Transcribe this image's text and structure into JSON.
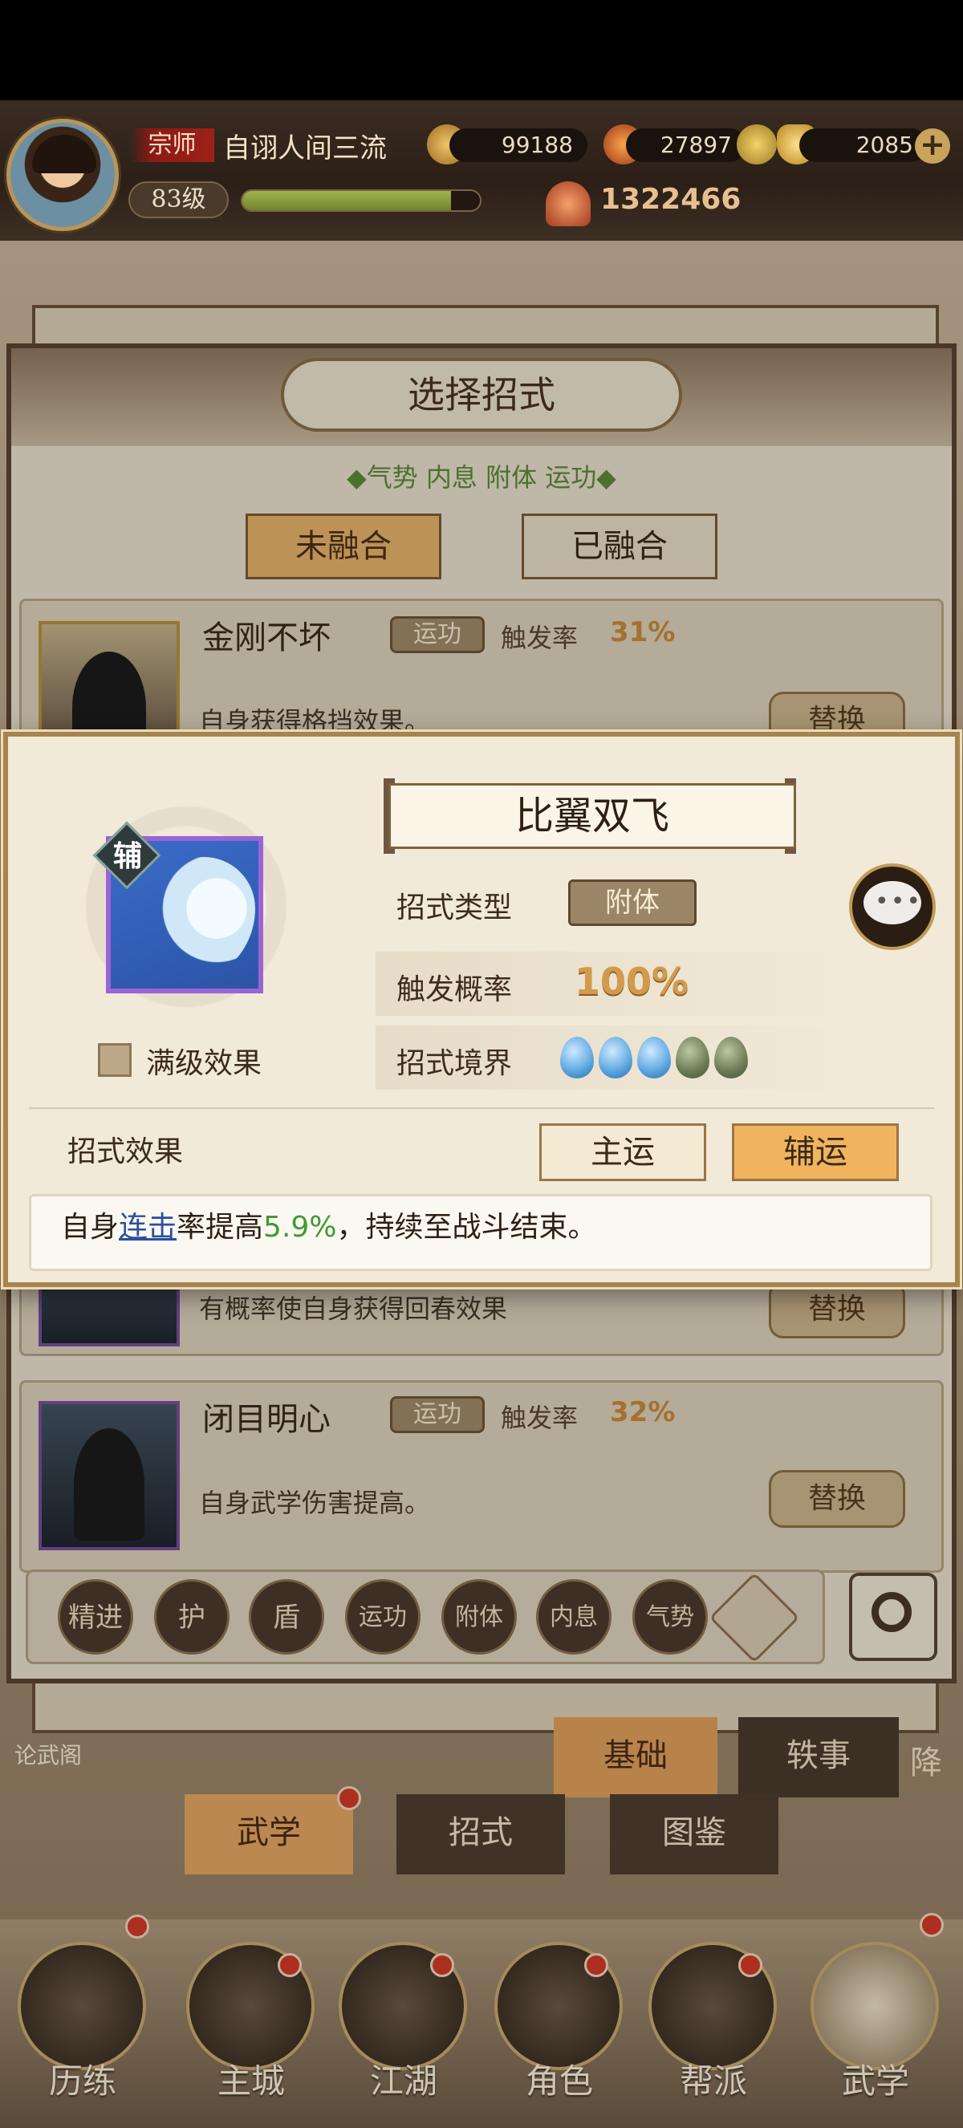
{
  "player": {
    "rank": "宗师",
    "name": "自诩人间三流",
    "level": "83级",
    "power": "1322466",
    "xp_fraction": 0.88
  },
  "currencies": [
    {
      "icon": "copper-coin-icon",
      "value": "99188"
    },
    {
      "icon": "stamina-flame-icon",
      "value": "27897"
    },
    {
      "icon": "gold-ingot-icon",
      "value": "2085"
    }
  ],
  "dialog": {
    "title": "选择招式",
    "filter_tags": "◆气势 内息 附体 运功◆",
    "tabs": [
      "未融合",
      "已融合"
    ]
  },
  "list": [
    {
      "name": "金刚不坏",
      "tag": "运功",
      "rate_label": "触发率",
      "rate": "31%",
      "desc": "自身获得格挡效果。",
      "button": "替换"
    },
    {
      "name": "",
      "tag": "",
      "rate_label": "",
      "rate": "",
      "desc": "有概率使自身获得回春效果",
      "button": "替换"
    },
    {
      "name": "闭目明心",
      "tag": "运功",
      "rate_label": "触发率",
      "rate": "32%",
      "desc": "自身武学伤害提高。",
      "button": "替换"
    }
  ],
  "filters": [
    "精进",
    "护",
    "盾",
    "运功",
    "附体",
    "内息",
    "气势"
  ],
  "subtabs": [
    "武学",
    "招式",
    "图鉴"
  ],
  "side_tabs": [
    "基础",
    "轶事"
  ],
  "side_left": "论武阁",
  "side_right": "降",
  "nav": [
    "历练",
    "主城",
    "江湖",
    "角色",
    "帮派",
    "武学"
  ],
  "modal": {
    "badge": "辅",
    "max_level_label": "满级效果",
    "skill_name": "比翼双飞",
    "type_label": "招式类型",
    "type_value": "附体",
    "rate_label": "触发概率",
    "rate_value": "100%",
    "realm_label": "招式境界",
    "realm_filled": 3,
    "realm_total": 5,
    "effect_label": "招式效果",
    "main_btn": "主运",
    "aux_btn": "辅运",
    "effect_pre": "自身",
    "effect_link": "连击",
    "effect_mid": "率提高",
    "effect_value": "5.9%",
    "effect_post": "，持续至战斗结束。"
  },
  "colors": {
    "accent": "#f0b45e",
    "green_value": "#3f9a35",
    "link": "#2b4f9e"
  }
}
